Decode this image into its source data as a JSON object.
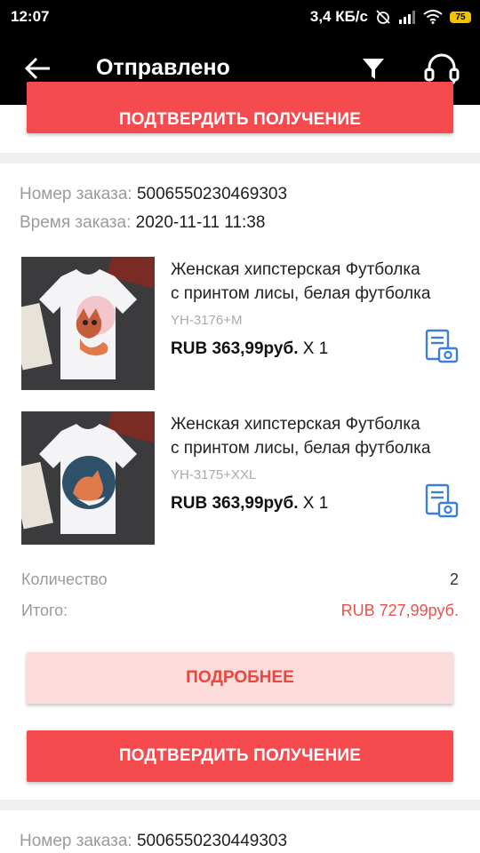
{
  "status_bar": {
    "time": "12:07",
    "speed": "3,4 КБ/с",
    "battery": "75"
  },
  "app_bar": {
    "title": "Отправлено",
    "icons": [
      "back-arrow-icon",
      "filter-icon",
      "headset-icon"
    ]
  },
  "previous_order": {
    "confirm_label": "ПОДТВЕРДИТЬ ПОЛУЧЕНИЕ"
  },
  "order": {
    "number_label": "Номер заказа:",
    "number": "5006550230469303",
    "time_label": "Время заказа:",
    "time": "2020-11-11 11:38",
    "items": [
      {
        "title_line1": "Женская хипстерская Футболка",
        "title_line2": "с принтом лисы, белая футболка",
        "sku": "YH-3176+M",
        "price": "RUB 363,99руб.",
        "qty": "X 1"
      },
      {
        "title_line1": "Женская хипстерская Футболка",
        "title_line2": "с принтом лисы, белая футболка",
        "sku": "YH-3175+XXL",
        "price": "RUB 363,99руб.",
        "qty": "X 1"
      }
    ],
    "quantity_label": "Количество",
    "quantity": "2",
    "total_label": "Итого:",
    "total": "RUB 727,99руб.",
    "details_label": "ПОДРОБНЕЕ",
    "confirm_label": "ПОДТВЕРДИТЬ ПОЛУЧЕНИЕ"
  },
  "next_order": {
    "number_label": "Номер заказа:",
    "number": "5006550230449303"
  },
  "colors": {
    "accent_red": "#f54b4f",
    "pink": "#fcdcda",
    "icon_blue": "#3b7fd6"
  }
}
